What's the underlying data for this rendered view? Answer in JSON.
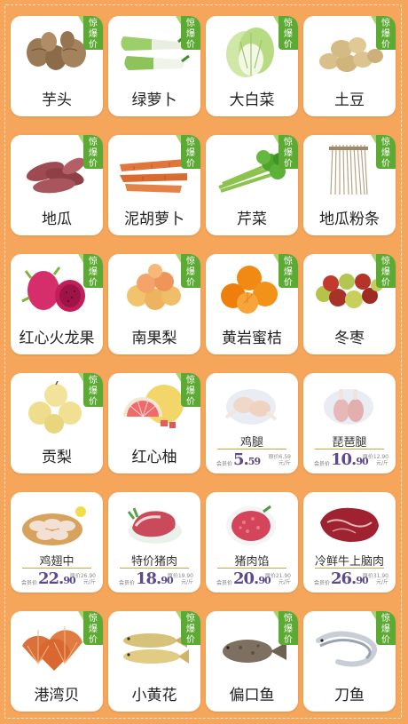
{
  "badge": {
    "line1": "惊",
    "line2": "爆",
    "line3": "价"
  },
  "member_label": "会员价",
  "unit": "元/斤",
  "items": [
    {
      "name": "芋头",
      "badge": true
    },
    {
      "name": "绿萝卜",
      "badge": true
    },
    {
      "name": "大白菜",
      "badge": true
    },
    {
      "name": "土豆",
      "badge": true
    },
    {
      "name": "地瓜",
      "badge": true
    },
    {
      "name": "泥胡萝卜",
      "badge": true
    },
    {
      "name": "芹菜",
      "badge": true
    },
    {
      "name": "地瓜粉条",
      "badge": true
    },
    {
      "name": "红心火龙果",
      "badge": true
    },
    {
      "name": "南果梨",
      "badge": true
    },
    {
      "name": "黄岩蜜桔",
      "badge": true
    },
    {
      "name": "冬枣",
      "badge": true
    },
    {
      "name": "贡梨",
      "badge": true
    },
    {
      "name": "红心柚",
      "badge": true
    },
    {
      "name": "鸡腿",
      "price_int": "5.",
      "price_dec": "59",
      "note": "原价6.59 元/斤"
    },
    {
      "name": "琵琶腿",
      "price_int": "10.",
      "price_dec": "90",
      "note": "原价12.90 元/斤"
    },
    {
      "name": "鸡翅中",
      "price_int": "22.",
      "price_dec": "90",
      "note": "原价26.90 元/斤"
    },
    {
      "name": "特价猪肉",
      "price_int": "18.",
      "price_dec": "90",
      "note": "原价19.90 元/斤"
    },
    {
      "name": "猪肉馅",
      "price_int": "20.",
      "price_dec": "90",
      "note": "原价21.90 元/斤"
    },
    {
      "name": "冷鲜牛上脑肉",
      "price_int": "26.",
      "price_dec": "90",
      "note": "原价31.90 元/斤"
    },
    {
      "name": "港湾贝",
      "badge": true
    },
    {
      "name": "小黄花",
      "badge": true
    },
    {
      "name": "偏口鱼",
      "badge": true
    },
    {
      "name": "刀鱼",
      "badge": true
    }
  ]
}
